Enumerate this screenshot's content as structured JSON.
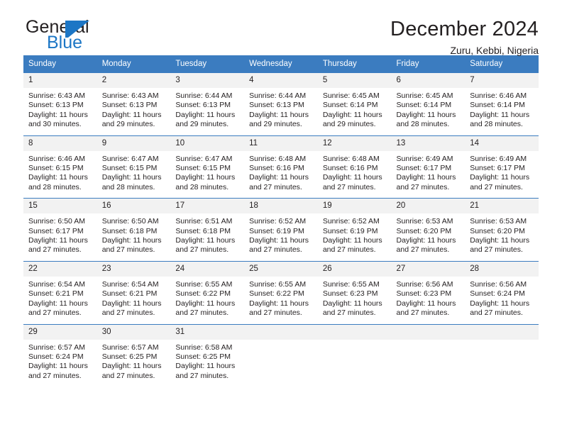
{
  "logo": {
    "word_top": "General",
    "word_bottom": "Blue",
    "accent_color": "#1c76c5"
  },
  "header": {
    "title": "December 2024",
    "subtitle": "Zuru, Kebbi, Nigeria"
  },
  "theme": {
    "header_blue": "#3b7cc0",
    "daynum_bg": "#f2f2f2",
    "text": "#231f20"
  },
  "weekdays": [
    "Sunday",
    "Monday",
    "Tuesday",
    "Wednesday",
    "Thursday",
    "Friday",
    "Saturday"
  ],
  "weeks": [
    [
      {
        "day": "1",
        "sunrise": "Sunrise: 6:43 AM",
        "sunset": "Sunset: 6:13 PM",
        "daylight": "Daylight: 11 hours and 30 minutes."
      },
      {
        "day": "2",
        "sunrise": "Sunrise: 6:43 AM",
        "sunset": "Sunset: 6:13 PM",
        "daylight": "Daylight: 11 hours and 29 minutes."
      },
      {
        "day": "3",
        "sunrise": "Sunrise: 6:44 AM",
        "sunset": "Sunset: 6:13 PM",
        "daylight": "Daylight: 11 hours and 29 minutes."
      },
      {
        "day": "4",
        "sunrise": "Sunrise: 6:44 AM",
        "sunset": "Sunset: 6:13 PM",
        "daylight": "Daylight: 11 hours and 29 minutes."
      },
      {
        "day": "5",
        "sunrise": "Sunrise: 6:45 AM",
        "sunset": "Sunset: 6:14 PM",
        "daylight": "Daylight: 11 hours and 29 minutes."
      },
      {
        "day": "6",
        "sunrise": "Sunrise: 6:45 AM",
        "sunset": "Sunset: 6:14 PM",
        "daylight": "Daylight: 11 hours and 28 minutes."
      },
      {
        "day": "7",
        "sunrise": "Sunrise: 6:46 AM",
        "sunset": "Sunset: 6:14 PM",
        "daylight": "Daylight: 11 hours and 28 minutes."
      }
    ],
    [
      {
        "day": "8",
        "sunrise": "Sunrise: 6:46 AM",
        "sunset": "Sunset: 6:15 PM",
        "daylight": "Daylight: 11 hours and 28 minutes."
      },
      {
        "day": "9",
        "sunrise": "Sunrise: 6:47 AM",
        "sunset": "Sunset: 6:15 PM",
        "daylight": "Daylight: 11 hours and 28 minutes."
      },
      {
        "day": "10",
        "sunrise": "Sunrise: 6:47 AM",
        "sunset": "Sunset: 6:15 PM",
        "daylight": "Daylight: 11 hours and 28 minutes."
      },
      {
        "day": "11",
        "sunrise": "Sunrise: 6:48 AM",
        "sunset": "Sunset: 6:16 PM",
        "daylight": "Daylight: 11 hours and 27 minutes."
      },
      {
        "day": "12",
        "sunrise": "Sunrise: 6:48 AM",
        "sunset": "Sunset: 6:16 PM",
        "daylight": "Daylight: 11 hours and 27 minutes."
      },
      {
        "day": "13",
        "sunrise": "Sunrise: 6:49 AM",
        "sunset": "Sunset: 6:17 PM",
        "daylight": "Daylight: 11 hours and 27 minutes."
      },
      {
        "day": "14",
        "sunrise": "Sunrise: 6:49 AM",
        "sunset": "Sunset: 6:17 PM",
        "daylight": "Daylight: 11 hours and 27 minutes."
      }
    ],
    [
      {
        "day": "15",
        "sunrise": "Sunrise: 6:50 AM",
        "sunset": "Sunset: 6:17 PM",
        "daylight": "Daylight: 11 hours and 27 minutes."
      },
      {
        "day": "16",
        "sunrise": "Sunrise: 6:50 AM",
        "sunset": "Sunset: 6:18 PM",
        "daylight": "Daylight: 11 hours and 27 minutes."
      },
      {
        "day": "17",
        "sunrise": "Sunrise: 6:51 AM",
        "sunset": "Sunset: 6:18 PM",
        "daylight": "Daylight: 11 hours and 27 minutes."
      },
      {
        "day": "18",
        "sunrise": "Sunrise: 6:52 AM",
        "sunset": "Sunset: 6:19 PM",
        "daylight": "Daylight: 11 hours and 27 minutes."
      },
      {
        "day": "19",
        "sunrise": "Sunrise: 6:52 AM",
        "sunset": "Sunset: 6:19 PM",
        "daylight": "Daylight: 11 hours and 27 minutes."
      },
      {
        "day": "20",
        "sunrise": "Sunrise: 6:53 AM",
        "sunset": "Sunset: 6:20 PM",
        "daylight": "Daylight: 11 hours and 27 minutes."
      },
      {
        "day": "21",
        "sunrise": "Sunrise: 6:53 AM",
        "sunset": "Sunset: 6:20 PM",
        "daylight": "Daylight: 11 hours and 27 minutes."
      }
    ],
    [
      {
        "day": "22",
        "sunrise": "Sunrise: 6:54 AM",
        "sunset": "Sunset: 6:21 PM",
        "daylight": "Daylight: 11 hours and 27 minutes."
      },
      {
        "day": "23",
        "sunrise": "Sunrise: 6:54 AM",
        "sunset": "Sunset: 6:21 PM",
        "daylight": "Daylight: 11 hours and 27 minutes."
      },
      {
        "day": "24",
        "sunrise": "Sunrise: 6:55 AM",
        "sunset": "Sunset: 6:22 PM",
        "daylight": "Daylight: 11 hours and 27 minutes."
      },
      {
        "day": "25",
        "sunrise": "Sunrise: 6:55 AM",
        "sunset": "Sunset: 6:22 PM",
        "daylight": "Daylight: 11 hours and 27 minutes."
      },
      {
        "day": "26",
        "sunrise": "Sunrise: 6:55 AM",
        "sunset": "Sunset: 6:23 PM",
        "daylight": "Daylight: 11 hours and 27 minutes."
      },
      {
        "day": "27",
        "sunrise": "Sunrise: 6:56 AM",
        "sunset": "Sunset: 6:23 PM",
        "daylight": "Daylight: 11 hours and 27 minutes."
      },
      {
        "day": "28",
        "sunrise": "Sunrise: 6:56 AM",
        "sunset": "Sunset: 6:24 PM",
        "daylight": "Daylight: 11 hours and 27 minutes."
      }
    ],
    [
      {
        "day": "29",
        "sunrise": "Sunrise: 6:57 AM",
        "sunset": "Sunset: 6:24 PM",
        "daylight": "Daylight: 11 hours and 27 minutes."
      },
      {
        "day": "30",
        "sunrise": "Sunrise: 6:57 AM",
        "sunset": "Sunset: 6:25 PM",
        "daylight": "Daylight: 11 hours and 27 minutes."
      },
      {
        "day": "31",
        "sunrise": "Sunrise: 6:58 AM",
        "sunset": "Sunset: 6:25 PM",
        "daylight": "Daylight: 11 hours and 27 minutes."
      },
      null,
      null,
      null,
      null
    ]
  ]
}
